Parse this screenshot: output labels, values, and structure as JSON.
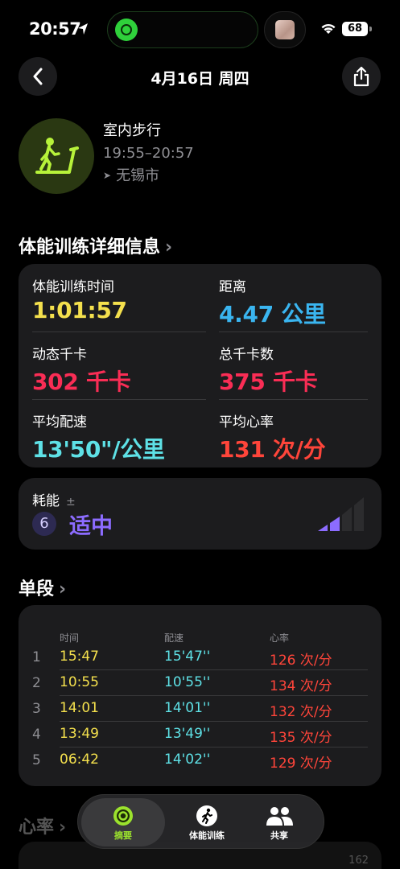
{
  "status": {
    "time": "20:57",
    "battery": "68"
  },
  "header": {
    "date": "4月16日 周四"
  },
  "workout": {
    "name": "室内步行",
    "time_range": "19:55–20:57",
    "location": "无锡市"
  },
  "details": {
    "title": "体能训练详细信息",
    "items": [
      {
        "label": "体能训练时间",
        "value": "1:01:57"
      },
      {
        "label": "距离",
        "value": "4.47 公里"
      },
      {
        "label": "动态千卡",
        "value": "302 千卡"
      },
      {
        "label": "总千卡数",
        "value": "375 千卡"
      },
      {
        "label": "平均配速",
        "value": "13'50\"/公里"
      },
      {
        "label": "平均心率",
        "value": "131 次/分"
      }
    ]
  },
  "effort": {
    "label": "耗能",
    "symbol": "±",
    "level": "6",
    "text": "适中",
    "bars_filled": 2,
    "bars_total": 4
  },
  "splits": {
    "title": "单段",
    "headers": [
      "时间",
      "配速",
      "心率"
    ],
    "rows": [
      {
        "index": "1",
        "time": "15:47",
        "pace": "15'47''",
        "hr": "126 次/分"
      },
      {
        "index": "2",
        "time": "10:55",
        "pace": "10'55''",
        "hr": "134 次/分"
      },
      {
        "index": "3",
        "time": "14:01",
        "pace": "14'01''",
        "hr": "132 次/分"
      },
      {
        "index": "4",
        "time": "13:49",
        "pace": "13'49''",
        "hr": "135 次/分"
      },
      {
        "index": "5",
        "time": "06:42",
        "pace": "14'02''",
        "hr": "129 次/分"
      }
    ]
  },
  "heart_rate": {
    "title": "心率",
    "value": "162"
  },
  "tabs": [
    {
      "label": "摘要",
      "icon": "activity-rings-icon"
    },
    {
      "label": "体能训练",
      "icon": "running-figure-icon"
    },
    {
      "label": "共享",
      "icon": "people-icon"
    }
  ],
  "colors": {
    "time": "#f4e04d",
    "distance": "#3ab5f0",
    "calories": "#fa2d55",
    "pace": "#5ee1e6",
    "heart": "#ff453a",
    "effort": "#8c6cff"
  }
}
